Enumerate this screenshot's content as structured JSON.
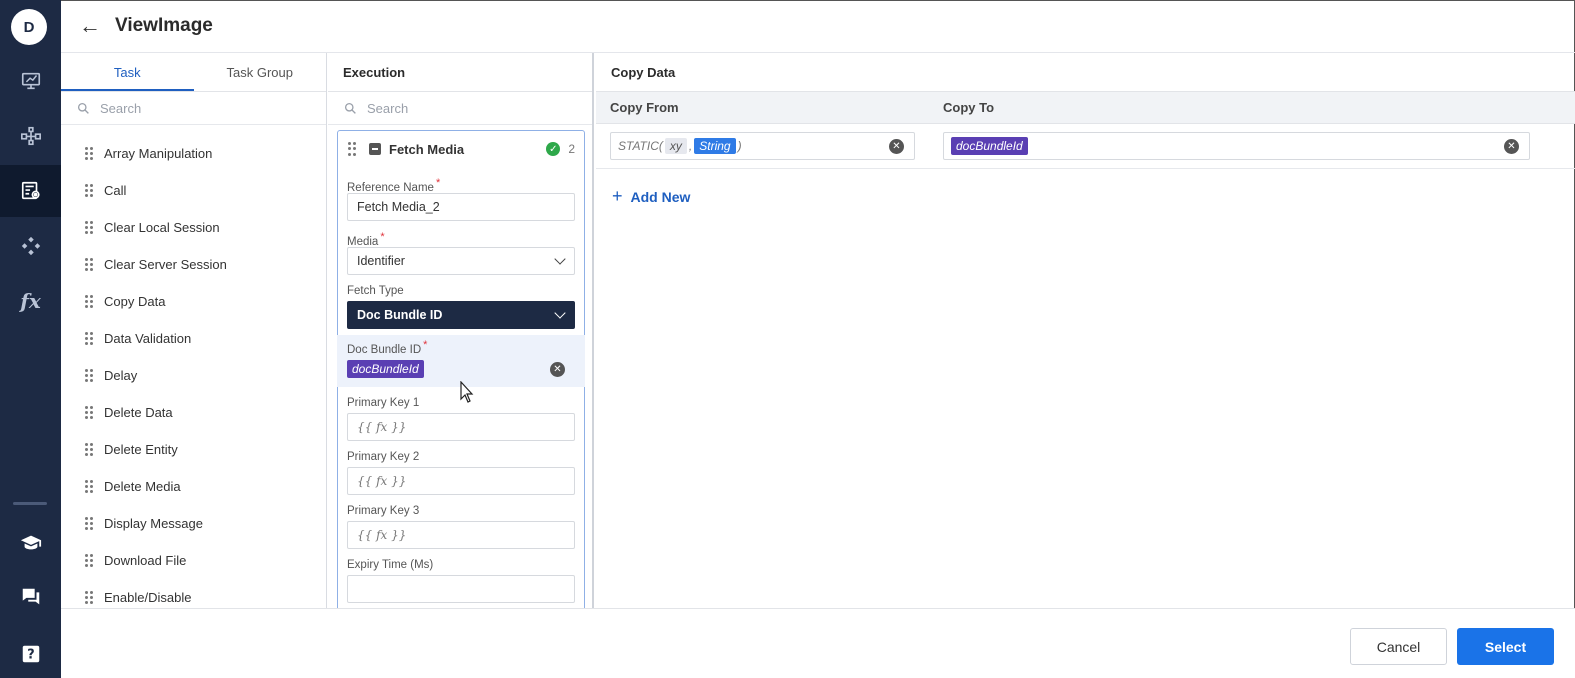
{
  "user": {
    "initial": "D"
  },
  "header": {
    "title": "ViewImage"
  },
  "task_panel": {
    "tabs": [
      {
        "label": "Task",
        "active": true
      },
      {
        "label": "Task Group",
        "active": false
      }
    ],
    "search_placeholder": "Search",
    "items": [
      "Array Manipulation",
      "Call",
      "Clear Local Session",
      "Clear Server Session",
      "Copy Data",
      "Data Validation",
      "Delay",
      "Delete Data",
      "Delete Entity",
      "Delete Media",
      "Display Message",
      "Download File",
      "Enable/Disable"
    ]
  },
  "execution": {
    "title": "Execution",
    "search_placeholder": "Search",
    "card": {
      "title": "Fetch Media",
      "count": "2",
      "reference_name_label": "Reference Name",
      "reference_name_value": "Fetch Media_2",
      "media_label": "Media",
      "media_value": "Identifier",
      "fetch_type_label": "Fetch Type",
      "fetch_type_value": "Doc Bundle ID",
      "doc_bundle_label": "Doc Bundle ID",
      "doc_bundle_value": "docBundleId",
      "pk1_label": "Primary Key 1",
      "pk1_value": "{{ fx }}",
      "pk2_label": "Primary Key 2",
      "pk2_value": "{{ fx }}",
      "pk3_label": "Primary Key 3",
      "pk3_value": "{{ fx }}",
      "expiry_label": "Expiry Time (Ms)"
    }
  },
  "copy_data": {
    "title": "Copy Data",
    "from_header": "Copy From",
    "to_header": "Copy To",
    "row": {
      "from_prefix": "STATIC(",
      "from_arg1": "xy",
      "from_sep": ",",
      "from_arg2": "String",
      "from_suffix": ")",
      "to_value": "docBundleId"
    },
    "add_new_label": "Add New"
  },
  "footer": {
    "cancel_label": "Cancel",
    "select_label": "Select"
  },
  "colors": {
    "rail": "#1d2a44",
    "accent": "#1a73e8",
    "chip": "#5a3fb3",
    "success": "#2ea84a"
  }
}
